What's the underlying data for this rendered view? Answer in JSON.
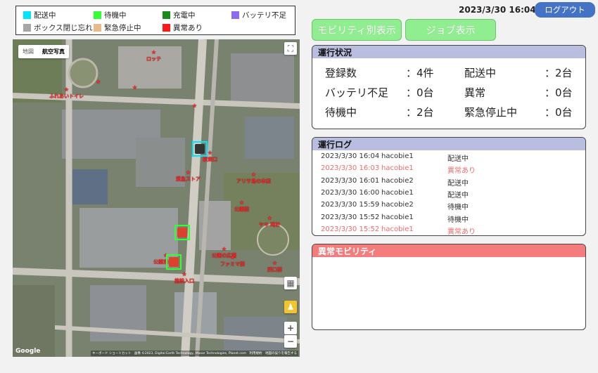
{
  "legend": [
    {
      "label": "配送中",
      "color": "#00e5ff"
    },
    {
      "label": "待機中",
      "color": "#33ff33"
    },
    {
      "label": "充電中",
      "color": "#1a8a1a"
    },
    {
      "label": "バッテリ不足",
      "color": "#8c6cf0"
    },
    {
      "label": "ボックス閉じ忘れ",
      "color": "#a6a6a6"
    },
    {
      "label": "緊急停止中",
      "color": "#e8b98a"
    },
    {
      "label": "異常あり",
      "color": "#ff1a1a"
    }
  ],
  "map": {
    "type_tabs": [
      "地図",
      "航空写真"
    ],
    "google": "Google",
    "attribution": "キーボード ショートカット　画像 ©2023, Digital Earth Technology, Maxar Technologies, Planet.com　利用規約　地図の誤りを報告する",
    "zoom_in": "+",
    "zoom_out": "−",
    "pois": [
      "ロッテ",
      "ふれあいトイレ",
      "",
      "",
      "",
      "駅東口",
      "緊急ストア",
      "アリサ島の本店",
      "公園前",
      "ヤキ 時計",
      "公園の広場",
      "ファミマ前",
      "西口前",
      "施設入口",
      "公園東の坂"
    ]
  },
  "header": {
    "datetime": "2023/3/30 16:04",
    "logout": "ログアウト"
  },
  "buttons": {
    "mobility_view": "モビリティ別表示",
    "job_view": "ジョブ表示"
  },
  "status_panel": {
    "title": "運行状況",
    "stats": [
      {
        "label": "登録数",
        "value": "：4件"
      },
      {
        "label": "配送中",
        "value": "：2台"
      },
      {
        "label": "バッテリ不足",
        "value": "：0台"
      },
      {
        "label": "異常",
        "value": "：0台"
      },
      {
        "label": "待機中",
        "value": "：2台"
      },
      {
        "label": "緊急停止中",
        "value": "：0台"
      }
    ]
  },
  "log_panel": {
    "title": "運行ログ",
    "rows": [
      {
        "time": "2023/3/30 16:04",
        "mobility": "hacobie1",
        "status": "配送中",
        "error": false
      },
      {
        "time": "2023/3/30 16:03",
        "mobility": "hacobie1",
        "status": "異常あり",
        "error": true
      },
      {
        "time": "2023/3/30 16:01",
        "mobility": "hacobie2",
        "status": "配送中",
        "error": false
      },
      {
        "time": "2023/3/30 16:00",
        "mobility": "hacobie1",
        "status": "配送中",
        "error": false
      },
      {
        "time": "2023/3/30 15:59",
        "mobility": "hacobie2",
        "status": "待機中",
        "error": false
      },
      {
        "time": "2023/3/30 15:52",
        "mobility": "hacobie1",
        "status": "待機中",
        "error": false
      },
      {
        "time": "2023/3/30 15:52",
        "mobility": "hacobie1",
        "status": "異常あり",
        "error": true
      }
    ]
  },
  "anomaly_panel": {
    "title": "異常モビリティ"
  },
  "robots": [
    {
      "status": "配送中",
      "color": "#00e5ff"
    },
    {
      "status": "待機中",
      "color": "#33ff33"
    },
    {
      "status": "待機中",
      "color": "#33ff33"
    }
  ]
}
